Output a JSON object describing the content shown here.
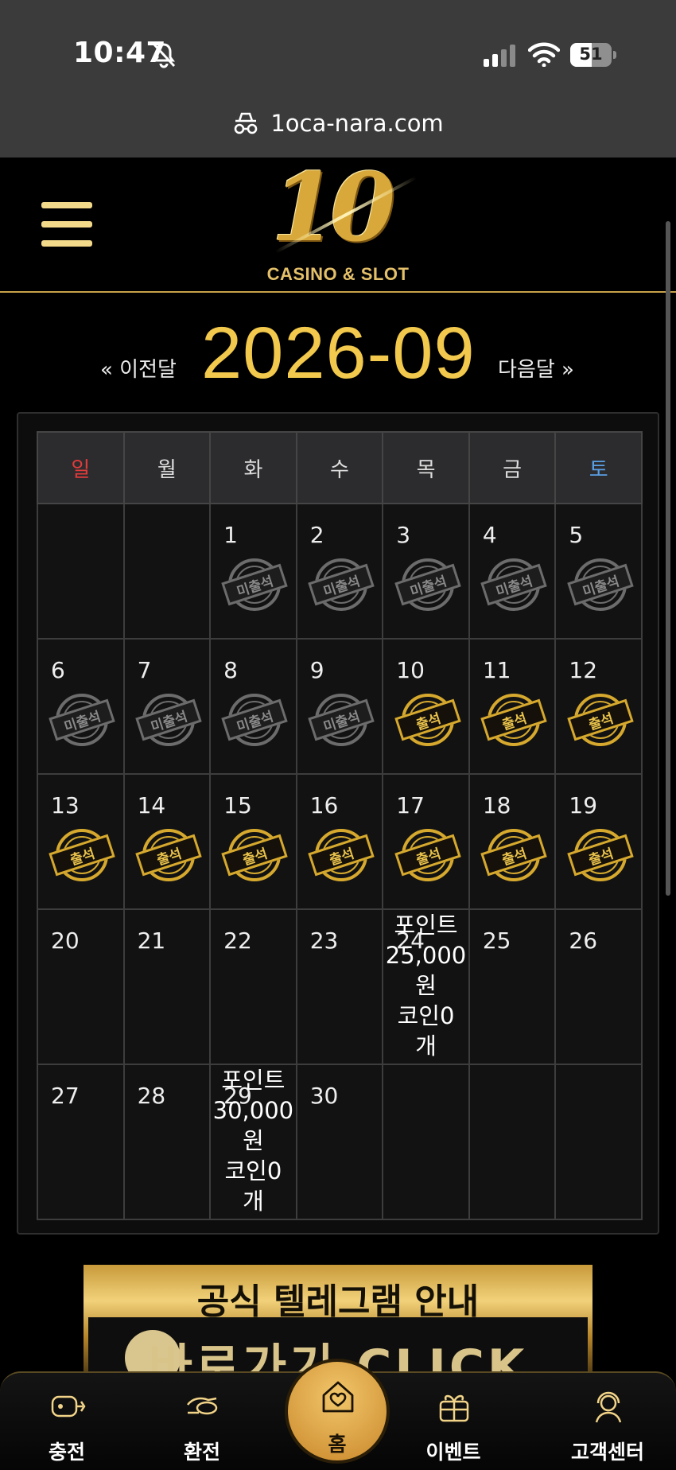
{
  "status_bar": {
    "time": "10:47",
    "battery": "51",
    "battery_level": 0.51
  },
  "browser": {
    "url": "1oca-nara.com"
  },
  "logo": {
    "number": "10",
    "subtitle": "CASINO & SLOT"
  },
  "calendar": {
    "prev_label": "« 이전달",
    "month": "2026-09",
    "next_label": "다음달 »",
    "weekdays": [
      "일",
      "월",
      "화",
      "수",
      "목",
      "금",
      "토"
    ],
    "stamp_absent": "미출석",
    "stamp_present": "출석",
    "weeks": [
      [
        {
          "day": ""
        },
        {
          "day": ""
        },
        {
          "day": "1",
          "stamp": "absent"
        },
        {
          "day": "2",
          "stamp": "absent"
        },
        {
          "day": "3",
          "stamp": "absent"
        },
        {
          "day": "4",
          "stamp": "absent"
        },
        {
          "day": "5",
          "stamp": "absent"
        }
      ],
      [
        {
          "day": "6",
          "stamp": "absent"
        },
        {
          "day": "7",
          "stamp": "absent"
        },
        {
          "day": "8",
          "stamp": "absent"
        },
        {
          "day": "9",
          "stamp": "absent"
        },
        {
          "day": "10",
          "stamp": "present"
        },
        {
          "day": "11",
          "stamp": "present"
        },
        {
          "day": "12",
          "stamp": "present"
        }
      ],
      [
        {
          "day": "13",
          "stamp": "present"
        },
        {
          "day": "14",
          "stamp": "present"
        },
        {
          "day": "15",
          "stamp": "present"
        },
        {
          "day": "16",
          "stamp": "present"
        },
        {
          "day": "17",
          "stamp": "present"
        },
        {
          "day": "18",
          "stamp": "present"
        },
        {
          "day": "19",
          "stamp": "present"
        }
      ],
      [
        {
          "day": "20"
        },
        {
          "day": "21"
        },
        {
          "day": "22"
        },
        {
          "day": "23"
        },
        {
          "day": "24",
          "reward": [
            "포인트",
            "25,000",
            "원",
            "코인0",
            "개"
          ]
        },
        {
          "day": "25"
        },
        {
          "day": "26"
        }
      ],
      [
        {
          "day": "27"
        },
        {
          "day": "28"
        },
        {
          "day": "29",
          "reward": [
            "포인트",
            "30,000",
            "원",
            "코인0",
            "개"
          ]
        },
        {
          "day": "30"
        },
        {
          "day": ""
        },
        {
          "day": ""
        },
        {
          "day": ""
        }
      ]
    ]
  },
  "banner": {
    "title": "공식 텔레그램 안내",
    "cta": "바로가기 CLICK"
  },
  "bottom_nav": {
    "charge": "충전",
    "exchange": "환전",
    "home": "홈",
    "event": "이벤트",
    "support": "고객센터"
  },
  "colors": {
    "accent_gold": "#f2c94c",
    "sunday": "#e23b3b",
    "saturday": "#5aa0e6"
  }
}
